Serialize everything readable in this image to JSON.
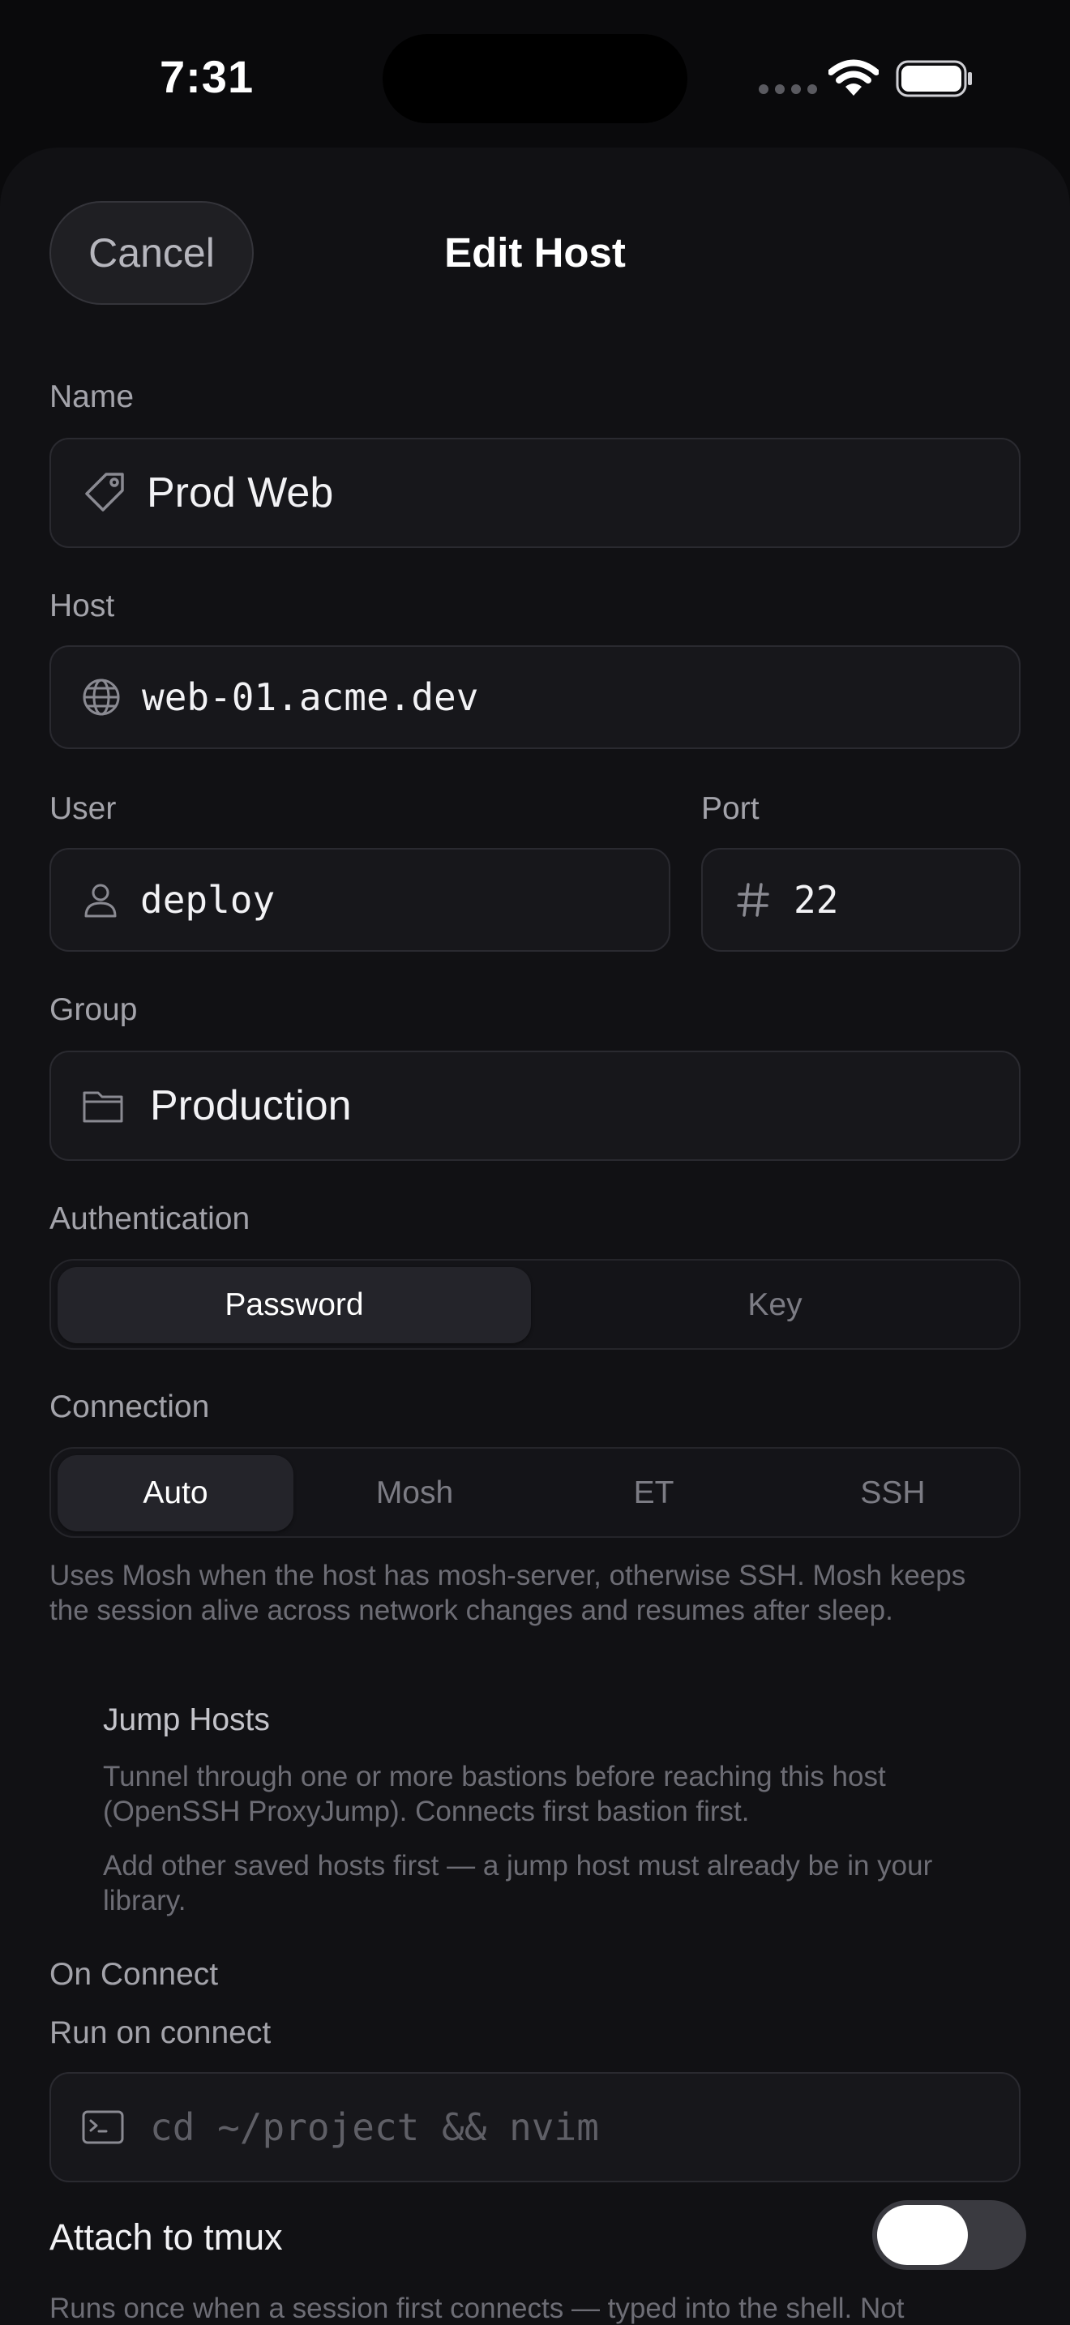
{
  "status_bar": {
    "time": "7:31"
  },
  "nav": {
    "cancel_label": "Cancel",
    "title": "Edit Host"
  },
  "form": {
    "name": {
      "label": "Name",
      "value": "Prod Web"
    },
    "host": {
      "label": "Host",
      "value": "web-01.acme.dev"
    },
    "user": {
      "label": "User",
      "value": "deploy"
    },
    "port": {
      "label": "Port",
      "value": "22"
    },
    "group": {
      "label": "Group",
      "value": "Production"
    },
    "authentication": {
      "label": "Authentication",
      "options": [
        "Password",
        "Key"
      ],
      "selected": "Password"
    },
    "connection": {
      "label": "Connection",
      "options": [
        "Auto",
        "Mosh",
        "ET",
        "SSH"
      ],
      "selected": "Auto",
      "description": "Uses Mosh when the host has mosh-server, otherwise SSH. Mosh keeps the session alive across network changes and resumes after sleep."
    },
    "jump_hosts": {
      "title": "Jump Hosts",
      "description": "Tunnel through one or more bastions before reaching this host (OpenSSH ProxyJump). Connects first bastion first.",
      "empty_note": "Add other saved hosts first — a jump host must already be in your library."
    },
    "on_connect": {
      "section_label": "On Connect",
      "run_label": "Run on connect",
      "run_placeholder": "cd ~/project && nvim",
      "tmux_label": "Attach to tmux",
      "tmux_enabled": false,
      "footer_text": "Runs once when a session first connects — typed into the shell. Not"
    }
  },
  "colors": {
    "background": "#111114",
    "field": "#17171b",
    "accent_text": "#ffffff",
    "muted_text": "#a3a3aa"
  }
}
